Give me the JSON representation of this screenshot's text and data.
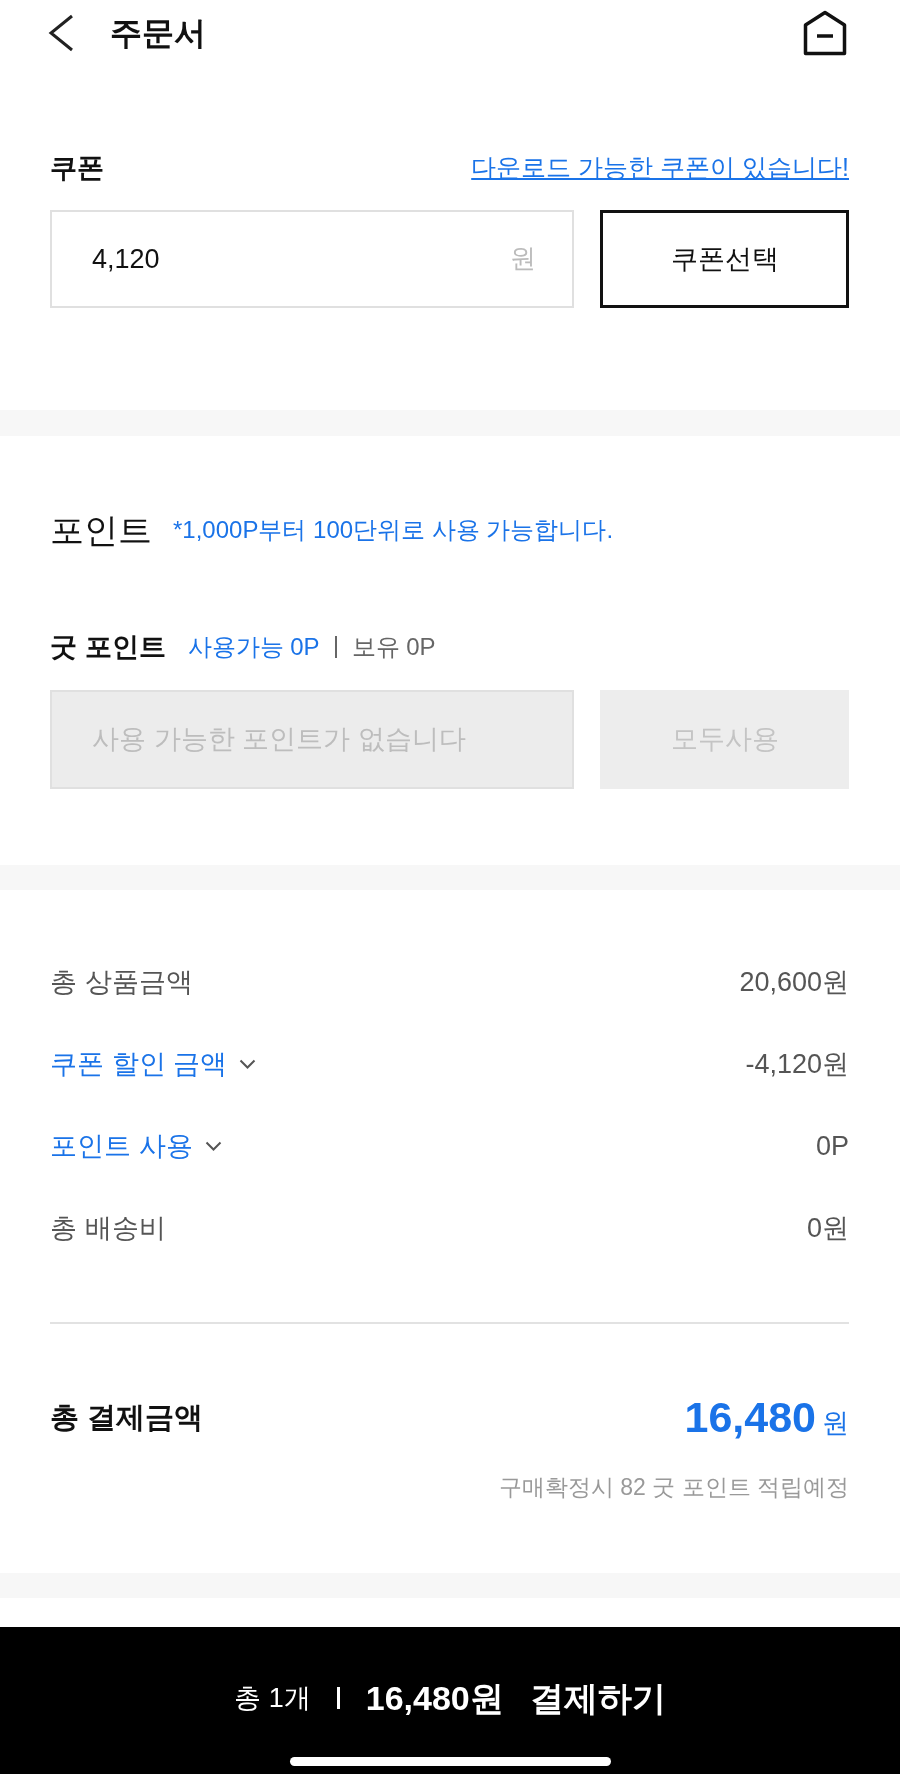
{
  "header": {
    "title": "주문서"
  },
  "coupon": {
    "label": "쿠폰",
    "download_link": "다운로드 가능한 쿠폰이 있습니다!",
    "field": {
      "value": "4,120",
      "unit": "원"
    },
    "select_button": "쿠폰선택"
  },
  "points": {
    "title": "포인트",
    "note": "*1,000P부터 100단위로 사용 가능합니다.",
    "good_point": {
      "label": "굿 포인트",
      "available": "사용가능 0P",
      "owned": "보유 0P"
    },
    "field": {
      "placeholder": "사용 가능한 포인트가 없습니다",
      "disabled": true
    },
    "use_all_button": {
      "label": "모두사용",
      "disabled": true
    }
  },
  "summary": {
    "rows": [
      {
        "kind": "plain",
        "label": "총 상품금액",
        "value": "20,600원"
      },
      {
        "kind": "expandable",
        "label": "쿠폰 할인 금액",
        "value": "-4,120원",
        "expanded": false
      },
      {
        "kind": "expandable",
        "label": "포인트 사용",
        "value": "0P",
        "expanded": false
      },
      {
        "kind": "plain",
        "label": "총 배송비",
        "value": "0원"
      }
    ],
    "total": {
      "label": "총 결제금액",
      "amount": "16,480",
      "unit": "원"
    },
    "reward_note": "구매확정시 82 굿 포인트 적립예정"
  },
  "bottom_bar": {
    "count": "총 1개",
    "amount": "16,480원",
    "action": "결제하기"
  }
}
